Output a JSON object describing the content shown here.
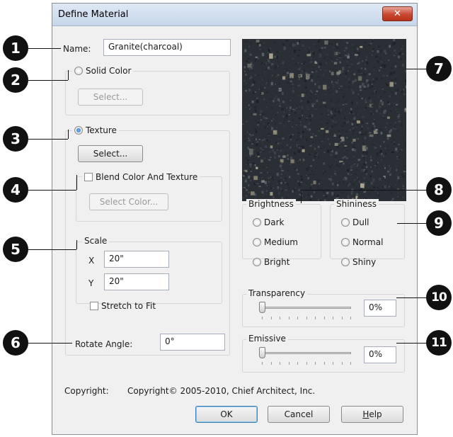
{
  "dialog": {
    "title": "Define Material",
    "close_glyph": "✕"
  },
  "name": {
    "label": "Name:",
    "value": "Granite(charcoal)"
  },
  "solid_color": {
    "label": "Solid Color",
    "selected": false,
    "select_button": "Select..."
  },
  "texture": {
    "label": "Texture",
    "selected": true,
    "select_button": "Select...",
    "blend": {
      "label": "Blend Color And Texture",
      "checked": false,
      "select_color_button": "Select Color..."
    },
    "scale": {
      "legend": "Scale",
      "x_label": "X",
      "x_value": "20\"",
      "y_label": "Y",
      "y_value": "20\"",
      "stretch_label": "Stretch to Fit",
      "stretch_checked": false
    }
  },
  "rotate": {
    "label": "Rotate Angle:",
    "value": "0°"
  },
  "brightness": {
    "legend": "Brightness",
    "options": [
      "Dark",
      "Medium",
      "Bright"
    ]
  },
  "shininess": {
    "legend": "Shininess",
    "options": [
      "Dull",
      "Normal",
      "Shiny"
    ]
  },
  "transparency": {
    "legend": "Transparency",
    "value": "0%",
    "level": 0
  },
  "emissive": {
    "legend": "Emissive",
    "value": "0%",
    "level": 0
  },
  "copyright": {
    "label": "Copyright:",
    "text": "Copyright© 2005-2010, Chief Architect, Inc."
  },
  "buttons": {
    "ok": "OK",
    "cancel": "Cancel",
    "help_mnemonic": "H",
    "help_rest": "elp"
  },
  "callouts": [
    "1",
    "2",
    "3",
    "4",
    "5",
    "6",
    "7",
    "8",
    "9",
    "10",
    "11"
  ],
  "colors": {
    "texture_base": "#2a2e35",
    "callout": "#111111",
    "title_bar": "#c6d6ea",
    "close_button": "#c9482f"
  },
  "icons": {
    "close": "close-icon"
  }
}
